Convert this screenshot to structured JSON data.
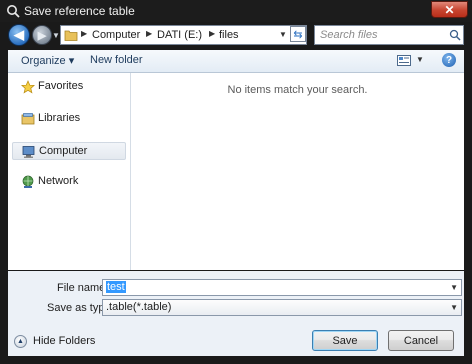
{
  "window": {
    "title": "Save reference table",
    "close_symbol": "✕"
  },
  "address": {
    "crumbs": [
      "Computer",
      "DATI (E:)",
      "files"
    ]
  },
  "search": {
    "placeholder": "Search files"
  },
  "toolbar": {
    "organize_label": "Organize ▾",
    "new_folder_label": "New folder"
  },
  "sidebar": {
    "items": [
      {
        "label": "Favorites",
        "icon": "star-icon"
      },
      {
        "label": "Libraries",
        "icon": "libraries-icon"
      },
      {
        "label": "Computer",
        "icon": "computer-icon",
        "selected": true
      },
      {
        "label": "Network",
        "icon": "network-icon"
      }
    ]
  },
  "files": {
    "empty_message": "No items match your search."
  },
  "form": {
    "file_name_label": "File name:",
    "file_name_value": "test",
    "save_type_label": "Save as type:",
    "save_type_value": ".table(*.table)"
  },
  "footer": {
    "hide_folders_label": "Hide Folders",
    "save_label": "Save",
    "cancel_label": "Cancel"
  },
  "colors": {
    "accent": "#3399ff",
    "close": "#c7442f",
    "frame": "#1a1a1a"
  }
}
